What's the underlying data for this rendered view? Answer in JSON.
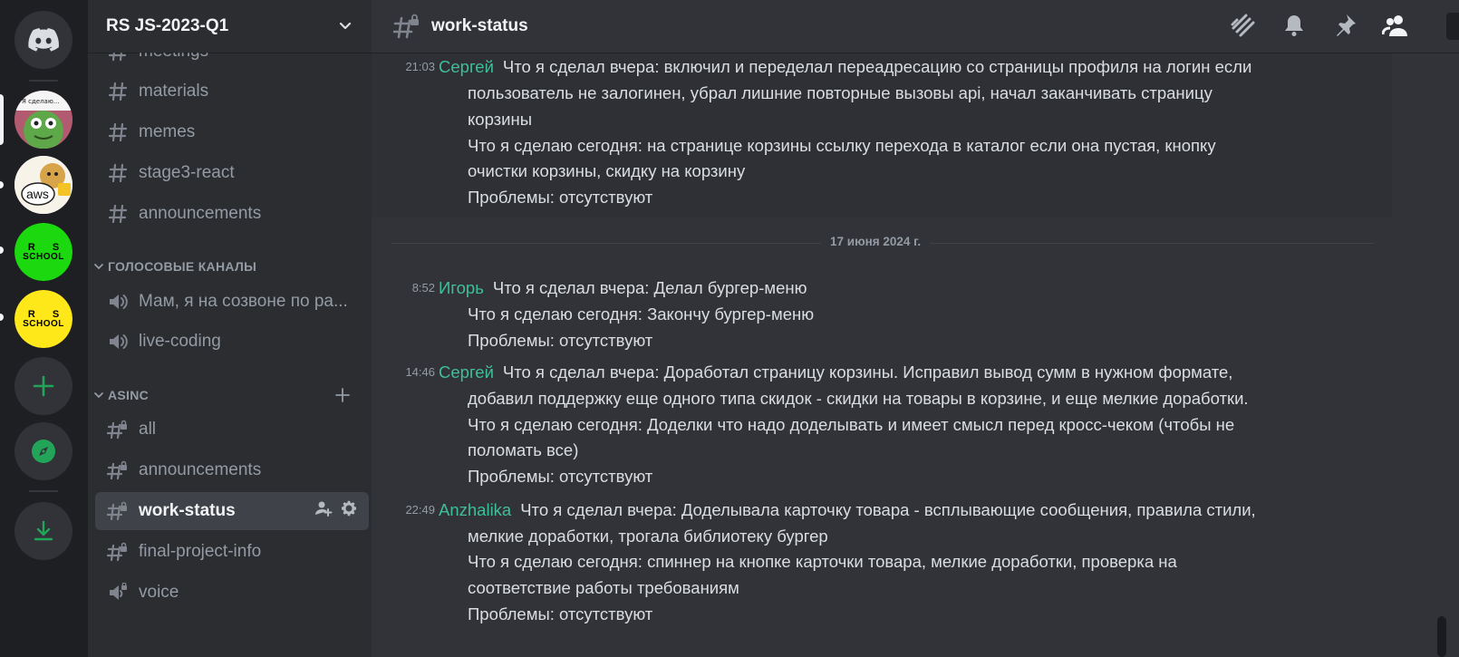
{
  "servers": {
    "home_icon": "discord-logo-icon",
    "items": [
      {
        "name": "server-avatar-frog",
        "label": "Я сделаю..."
      },
      {
        "name": "server-avatar-aws",
        "label": "aws"
      },
      {
        "name": "server-avatar-rs-school-green",
        "label_top": "R S",
        "label_bottom": "SCHOOL",
        "color": "#1bd90e"
      },
      {
        "name": "server-avatar-rs-school-yellow",
        "label_top": "R S",
        "label_bottom": "SCHOOL",
        "color": "#ffe81a"
      }
    ],
    "actions": [
      "add-server-icon",
      "explore-icon",
      "download-icon"
    ]
  },
  "sidebar": {
    "guild_name": "RS JS-2023-Q1",
    "channels_top": [
      {
        "label": "meetings"
      },
      {
        "label": "materials"
      },
      {
        "label": "memes"
      },
      {
        "label": "stage3-react"
      },
      {
        "label": "announcements"
      }
    ],
    "voice_category": "ГОЛОСОВЫЕ КАНАЛЫ",
    "voice_channels": [
      {
        "label": "Мам, я на созвоне по ра..."
      },
      {
        "label": "live-coding"
      }
    ],
    "asinc_category": "ASINC",
    "asinc_channels": [
      {
        "label": "all"
      },
      {
        "label": "announcements"
      },
      {
        "label": "work-status"
      },
      {
        "label": "final-project-info"
      },
      {
        "label": "voice"
      }
    ]
  },
  "header": {
    "channel_name": "work-status",
    "toolbar": [
      "threads-icon",
      "notification-bell-icon",
      "pin-icon",
      "member-list-icon"
    ]
  },
  "messages": {
    "m1": {
      "time": "21:03",
      "author": "Сергей",
      "lines": [
        "Что я сделал вчера: включил и переделал переадресацию со страницы профиля на логин если",
        "пользователь не залогинен, убрал лишние повторные вызовы api, начал заканчивать страницу",
        "корзины",
        "Что я сделаю сегодня: на странице корзины ссылку перехода в каталог если она пустая, кнопку",
        "очистки корзины, скидку на корзину",
        "Проблемы: отсутствуют"
      ]
    },
    "date_divider": "17 июня 2024 г.",
    "m2": {
      "time": "8:52",
      "author": "Игорь",
      "lines": [
        "Что я сделал вчера: Делал бургер-меню",
        "Что я сделаю сегодня: Закончу бургер-меню",
        "Проблемы: отсутствуют"
      ]
    },
    "m3": {
      "time": "14:46",
      "author": "Сергей",
      "lines": [
        "Что я сделал вчера: Доработал страницу корзины. Исправил вывод сумм в нужном формате,",
        "добавил поддержку еще одного типа скидок - скидки на товары в корзине, и еще мелкие доработки.",
        "Что я сделаю сегодня: Доделки что надо доделывать и имеет смысл перед кросс-чеком (чтобы не",
        "поломать все)",
        "Проблемы: отсутствуют"
      ]
    },
    "m4": {
      "time": "22:49",
      "author": "Anzhalika",
      "lines": [
        "Что я сделал вчера: Доделывала карточку товара - всплывающие сообщения, правила стили,",
        "мелкие доработки, трогала библиотеку бургер",
        "Что я сделаю сегодня: спиннер на кнопке карточки товара, мелкие доработки, проверка на",
        "соответствие работы требованиям",
        "Проблемы: отсутствуют"
      ]
    }
  },
  "colors": {
    "author": "#3fbf99",
    "accent_green": "#23a559"
  }
}
